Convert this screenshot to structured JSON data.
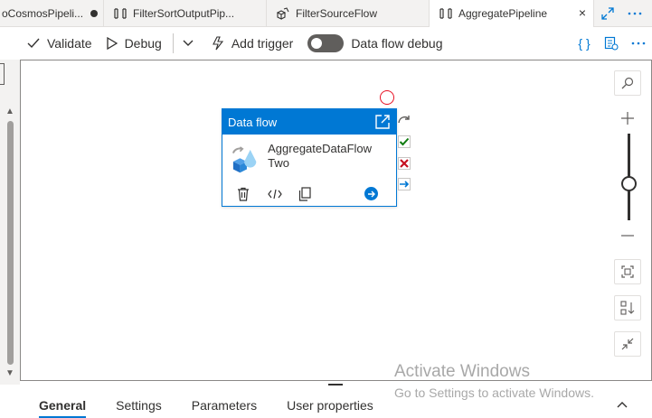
{
  "tabs": [
    {
      "label": "oCosmosPipeli...",
      "dirty": true,
      "active": false
    },
    {
      "label": "FilterSortOutputPip...",
      "active": false
    },
    {
      "label": "FilterSourceFlow",
      "active": false
    },
    {
      "label": "AggregatePipeline",
      "active": true
    }
  ],
  "tab_actions": {
    "close": "×"
  },
  "toolbar": {
    "validate": "Validate",
    "debug": "Debug",
    "add_trigger": "Add trigger",
    "data_flow_debug": "Data flow debug",
    "code_icon_text": "{ }"
  },
  "node": {
    "header": "Data flow",
    "title": "AggregateDataFlow Two"
  },
  "watermark": {
    "title": "Activate Windows",
    "subtitle": "Go to Settings to activate Windows."
  },
  "bottom_tabs": [
    "General",
    "Settings",
    "Parameters",
    "User properties"
  ],
  "colors": {
    "accent": "#0078d4",
    "success": "#107c10",
    "fail": "#c50f1f",
    "debug_toggle": "#605e5c"
  }
}
